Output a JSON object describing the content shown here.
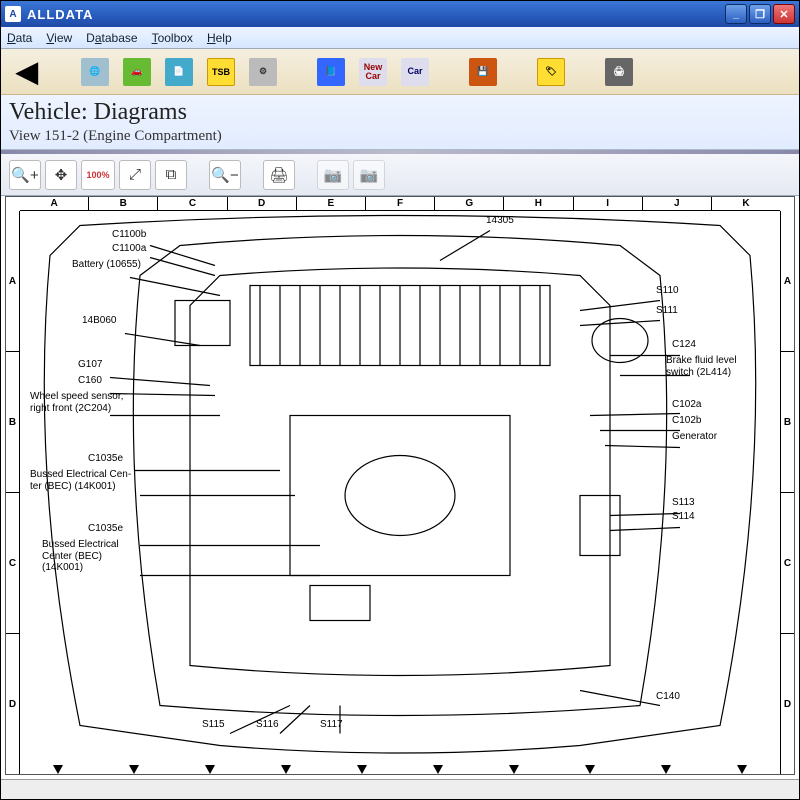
{
  "window": {
    "title": "ALLDATA",
    "icon_text": "A"
  },
  "menu": [
    "Data",
    "View",
    "Database",
    "Toolbox",
    "Help"
  ],
  "toolbar_main": {
    "back_icon": "◀",
    "icons": [
      "globe",
      "seat",
      "doc",
      "tsb",
      "gear",
      "book",
      "newcar",
      "car",
      "save",
      "tag",
      "print"
    ],
    "newcar_label": "New\nCar",
    "car_label": "Car"
  },
  "header": {
    "title": "Vehicle:  Diagrams",
    "subtitle": "View 151-2 (Engine Compartment)"
  },
  "view_toolbar": {
    "zoom_in": "🔍+",
    "pan": "✥",
    "pct": "100%",
    "zoom_fit": "⤢",
    "zoom_region": "⧉",
    "zoom_out": "🔍−",
    "print": "🖨",
    "cam1": "📷",
    "cam2": "📷"
  },
  "ruler": {
    "cols": [
      "A",
      "B",
      "C",
      "D",
      "E",
      "F",
      "G",
      "H",
      "I",
      "J",
      "K"
    ],
    "rows_left": [
      "A",
      "B",
      "C",
      "D"
    ],
    "rows_right": [
      "A",
      "B",
      "C",
      "D"
    ]
  },
  "callouts_left": [
    {
      "id": "c1100b",
      "text": "C1100b"
    },
    {
      "id": "c1100a",
      "text": "C1100a"
    },
    {
      "id": "battery",
      "text": "Battery (10655)"
    },
    {
      "id": "n14b060",
      "text": "14B060"
    },
    {
      "id": "g107",
      "text": "G107"
    },
    {
      "id": "c160",
      "text": "C160"
    },
    {
      "id": "wheel",
      "text": "Wheel speed sensor,\nright front (2C204)"
    },
    {
      "id": "c1035e",
      "text": "C1035e"
    },
    {
      "id": "bec1",
      "text": "Bussed Electrical Cen-\nter (BEC) (14K001)"
    },
    {
      "id": "c1035e2",
      "text": "C1035e"
    },
    {
      "id": "bec2",
      "text": "Bussed Electrical\nCenter (BEC)\n(14K001)"
    },
    {
      "id": "s115",
      "text": "S115"
    },
    {
      "id": "s116",
      "text": "S116"
    },
    {
      "id": "s117",
      "text": "S117"
    }
  ],
  "callouts_right": [
    {
      "id": "n14305",
      "text": "14305"
    },
    {
      "id": "s110",
      "text": "S110"
    },
    {
      "id": "s111",
      "text": "S111"
    },
    {
      "id": "c124",
      "text": "C124"
    },
    {
      "id": "brake",
      "text": "Brake fluid level\nswitch (2L414)"
    },
    {
      "id": "c102a",
      "text": "C102a"
    },
    {
      "id": "c102b",
      "text": "C102b"
    },
    {
      "id": "gen",
      "text": "Generator"
    },
    {
      "id": "s113",
      "text": "S113"
    },
    {
      "id": "s114",
      "text": "S114"
    },
    {
      "id": "c140",
      "text": "C140"
    }
  ],
  "status": {
    "left": "",
    "right": ""
  }
}
